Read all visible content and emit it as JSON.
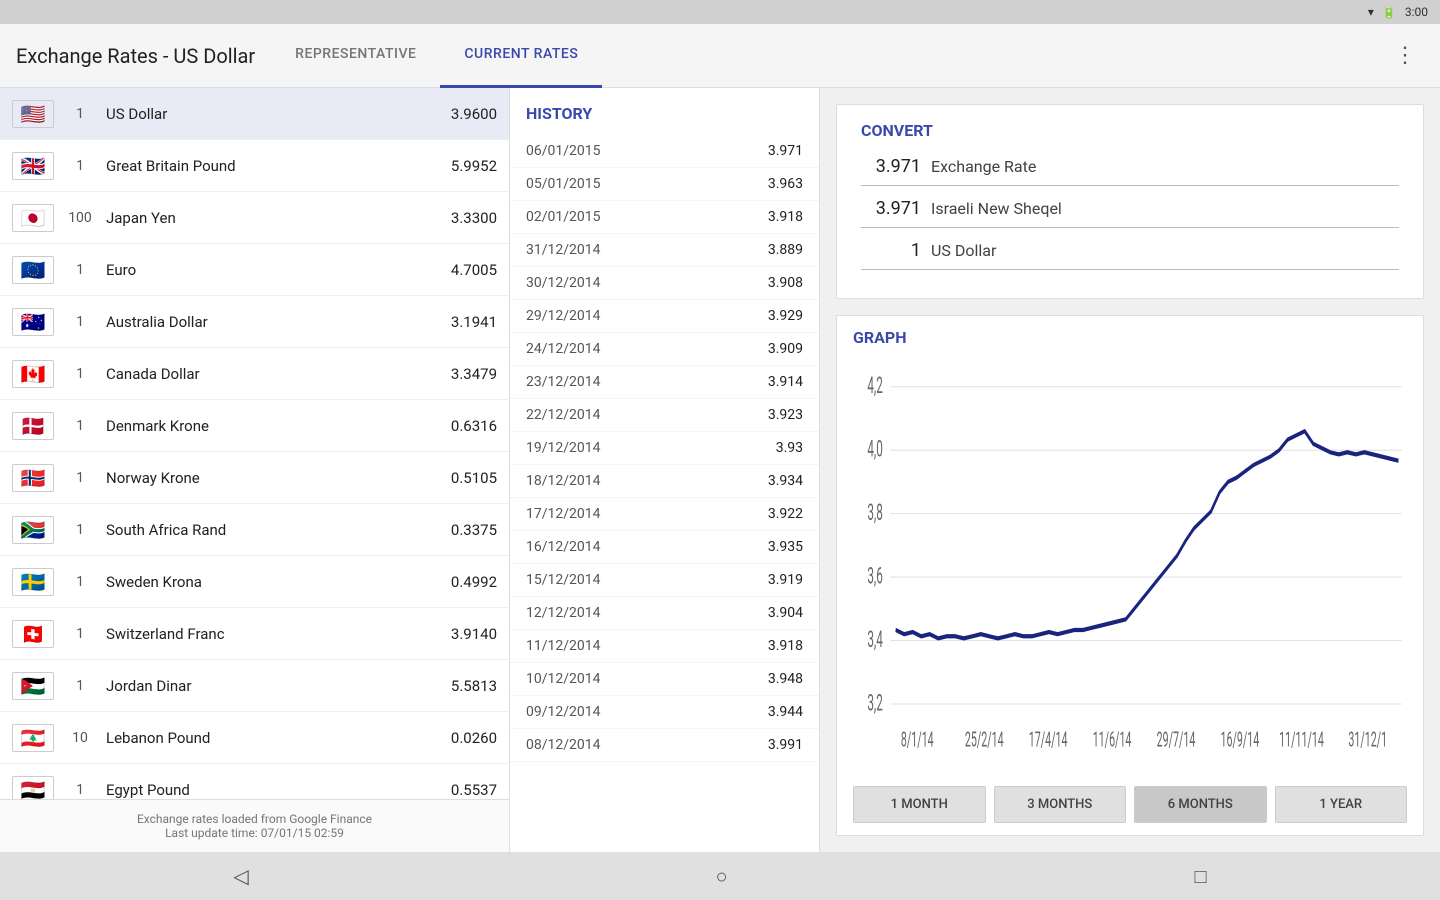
{
  "statusBar": {
    "time": "3:00",
    "wifi": "wifi",
    "battery": "battery"
  },
  "appBar": {
    "title": "Exchange Rates - US Dollar",
    "tabs": [
      {
        "label": "REPRESENTATIVE",
        "active": false
      },
      {
        "label": "CURRENT RATES",
        "active": true
      }
    ],
    "menuIcon": "⋮"
  },
  "currencyList": {
    "currencies": [
      {
        "flag": "us",
        "multiplier": "1",
        "name": "US Dollar",
        "rate": "3.9600",
        "selected": true
      },
      {
        "flag": "gb",
        "multiplier": "1",
        "name": "Great Britain Pound",
        "rate": "5.9952"
      },
      {
        "flag": "jp",
        "multiplier": "100",
        "name": "Japan Yen",
        "rate": "3.3300"
      },
      {
        "flag": "eu",
        "multiplier": "1",
        "name": "Euro",
        "rate": "4.7005"
      },
      {
        "flag": "au",
        "multiplier": "1",
        "name": "Australia Dollar",
        "rate": "3.1941"
      },
      {
        "flag": "ca",
        "multiplier": "1",
        "name": "Canada Dollar",
        "rate": "3.3479"
      },
      {
        "flag": "dk",
        "multiplier": "1",
        "name": "Denmark Krone",
        "rate": "0.6316"
      },
      {
        "flag": "no",
        "multiplier": "1",
        "name": "Norway Krone",
        "rate": "0.5105"
      },
      {
        "flag": "za",
        "multiplier": "1",
        "name": "South Africa Rand",
        "rate": "0.3375"
      },
      {
        "flag": "se",
        "multiplier": "1",
        "name": "Sweden Krona",
        "rate": "0.4992"
      },
      {
        "flag": "ch",
        "multiplier": "1",
        "name": "Switzerland Franc",
        "rate": "3.9140"
      },
      {
        "flag": "jo",
        "multiplier": "1",
        "name": "Jordan Dinar",
        "rate": "5.5813"
      },
      {
        "flag": "lb",
        "multiplier": "10",
        "name": "Lebanon Pound",
        "rate": "0.0260"
      },
      {
        "flag": "eg",
        "multiplier": "1",
        "name": "Egypt Pound",
        "rate": "0.5537"
      }
    ],
    "footer": {
      "line1": "Exchange rates loaded from Google Finance",
      "line2": "Last update time: 07/01/15 02:59"
    }
  },
  "history": {
    "title": "HISTORY",
    "rows": [
      {
        "date": "06/01/2015",
        "value": "3.971"
      },
      {
        "date": "05/01/2015",
        "value": "3.963"
      },
      {
        "date": "02/01/2015",
        "value": "3.918"
      },
      {
        "date": "31/12/2014",
        "value": "3.889"
      },
      {
        "date": "30/12/2014",
        "value": "3.908"
      },
      {
        "date": "29/12/2014",
        "value": "3.929"
      },
      {
        "date": "24/12/2014",
        "value": "3.909"
      },
      {
        "date": "23/12/2014",
        "value": "3.914"
      },
      {
        "date": "22/12/2014",
        "value": "3.923"
      },
      {
        "date": "19/12/2014",
        "value": "3.93"
      },
      {
        "date": "18/12/2014",
        "value": "3.934"
      },
      {
        "date": "17/12/2014",
        "value": "3.922"
      },
      {
        "date": "16/12/2014",
        "value": "3.935"
      },
      {
        "date": "15/12/2014",
        "value": "3.919"
      },
      {
        "date": "12/12/2014",
        "value": "3.904"
      },
      {
        "date": "11/12/2014",
        "value": "3.918"
      },
      {
        "date": "10/12/2014",
        "value": "3.948"
      },
      {
        "date": "09/12/2014",
        "value": "3.944"
      },
      {
        "date": "08/12/2014",
        "value": "3.991"
      }
    ]
  },
  "convert": {
    "title": "CONVERT",
    "rows": [
      {
        "number": "3.971",
        "label": "Exchange Rate"
      },
      {
        "number": "3.971",
        "label": "Israeli New Sheqel"
      },
      {
        "number": "1",
        "label": "US Dollar"
      }
    ]
  },
  "graph": {
    "title": "GRAPH",
    "xLabels": [
      "8/1/14",
      "25/2/14",
      "17/4/14",
      "11/6/14",
      "29/7/14",
      "16/9/14",
      "11/11/14",
      "31/12/1"
    ],
    "yLabels": [
      "4,2",
      "4,0",
      "3,8",
      "3,6",
      "3,4",
      "3,2"
    ],
    "buttons": [
      {
        "label": "1 MONTH",
        "active": false
      },
      {
        "label": "3 MONTHS",
        "active": false
      },
      {
        "label": "6 MONTHS",
        "active": true
      },
      {
        "label": "1 YEAR",
        "active": false
      }
    ]
  },
  "navBar": {
    "back": "◁",
    "home": "○",
    "recents": "□"
  }
}
